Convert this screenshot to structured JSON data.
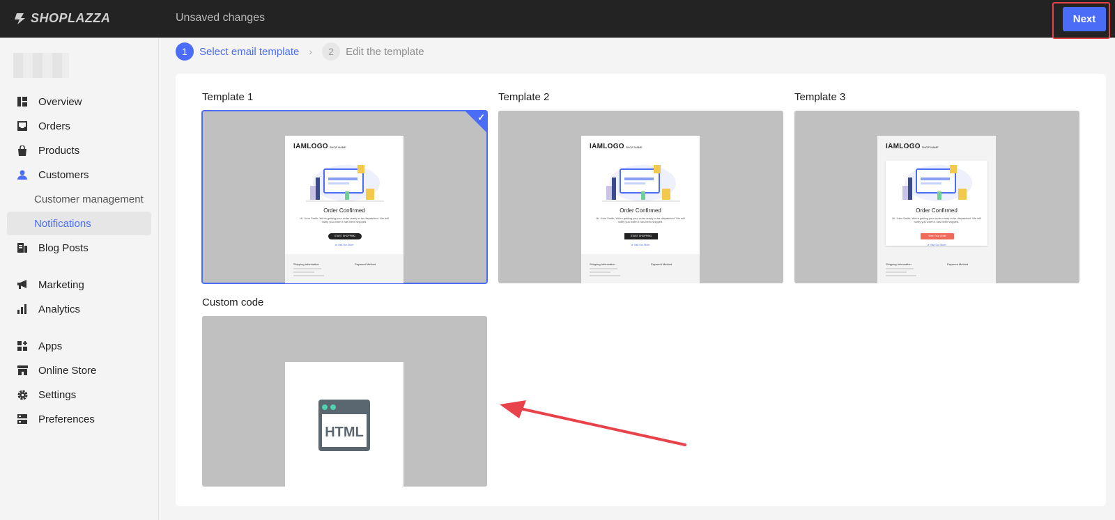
{
  "app": {
    "brand": "SHOPLAZZA",
    "unsaved_text": "Unsaved changes",
    "next_label": "Next"
  },
  "sidebar": {
    "items": [
      {
        "label": "Overview",
        "icon": "overview-icon"
      },
      {
        "label": "Orders",
        "icon": "inbox-icon"
      },
      {
        "label": "Products",
        "icon": "bag-icon"
      },
      {
        "label": "Customers",
        "icon": "person-icon"
      },
      {
        "label": "Blog Posts",
        "icon": "blog-icon"
      },
      {
        "label": "Marketing",
        "icon": "megaphone-icon"
      },
      {
        "label": "Analytics",
        "icon": "bar-chart-icon"
      },
      {
        "label": "Apps",
        "icon": "apps-icon"
      },
      {
        "label": "Online Store",
        "icon": "store-icon"
      },
      {
        "label": "Settings",
        "icon": "gear-icon"
      },
      {
        "label": "Preferences",
        "icon": "preferences-icon"
      }
    ],
    "customer_sub": [
      {
        "label": "Customer management",
        "active": false
      },
      {
        "label": "Notifications",
        "active": true
      }
    ]
  },
  "steps": [
    {
      "num": "1",
      "label": "Select email template",
      "active": true
    },
    {
      "num": "2",
      "label": "Edit the template",
      "active": false
    }
  ],
  "templates": [
    {
      "label": "Template 1",
      "selected": true
    },
    {
      "label": "Template 2",
      "selected": false
    },
    {
      "label": "Template 3",
      "selected": false
    },
    {
      "label": "Custom code",
      "selected": false
    }
  ],
  "email_preview": {
    "brand": "IAMLOGO",
    "shop_name": "SHOP NAME",
    "title": "Order Confirmed",
    "body": "Hi, John Smith, We're getting your order ready to be dispatched. We will notify you when it has been shipped.",
    "cta_t1": "START SHOPPING",
    "cta_t3": "View Your Order",
    "link": "or Visit Our Store",
    "shipping": "Shipping Information",
    "payment": "Payment Method"
  },
  "custom_code_text": "HTML",
  "colors": {
    "accent": "#4a6cf7",
    "highlight": "#e8434a",
    "topbar": "#232323"
  }
}
